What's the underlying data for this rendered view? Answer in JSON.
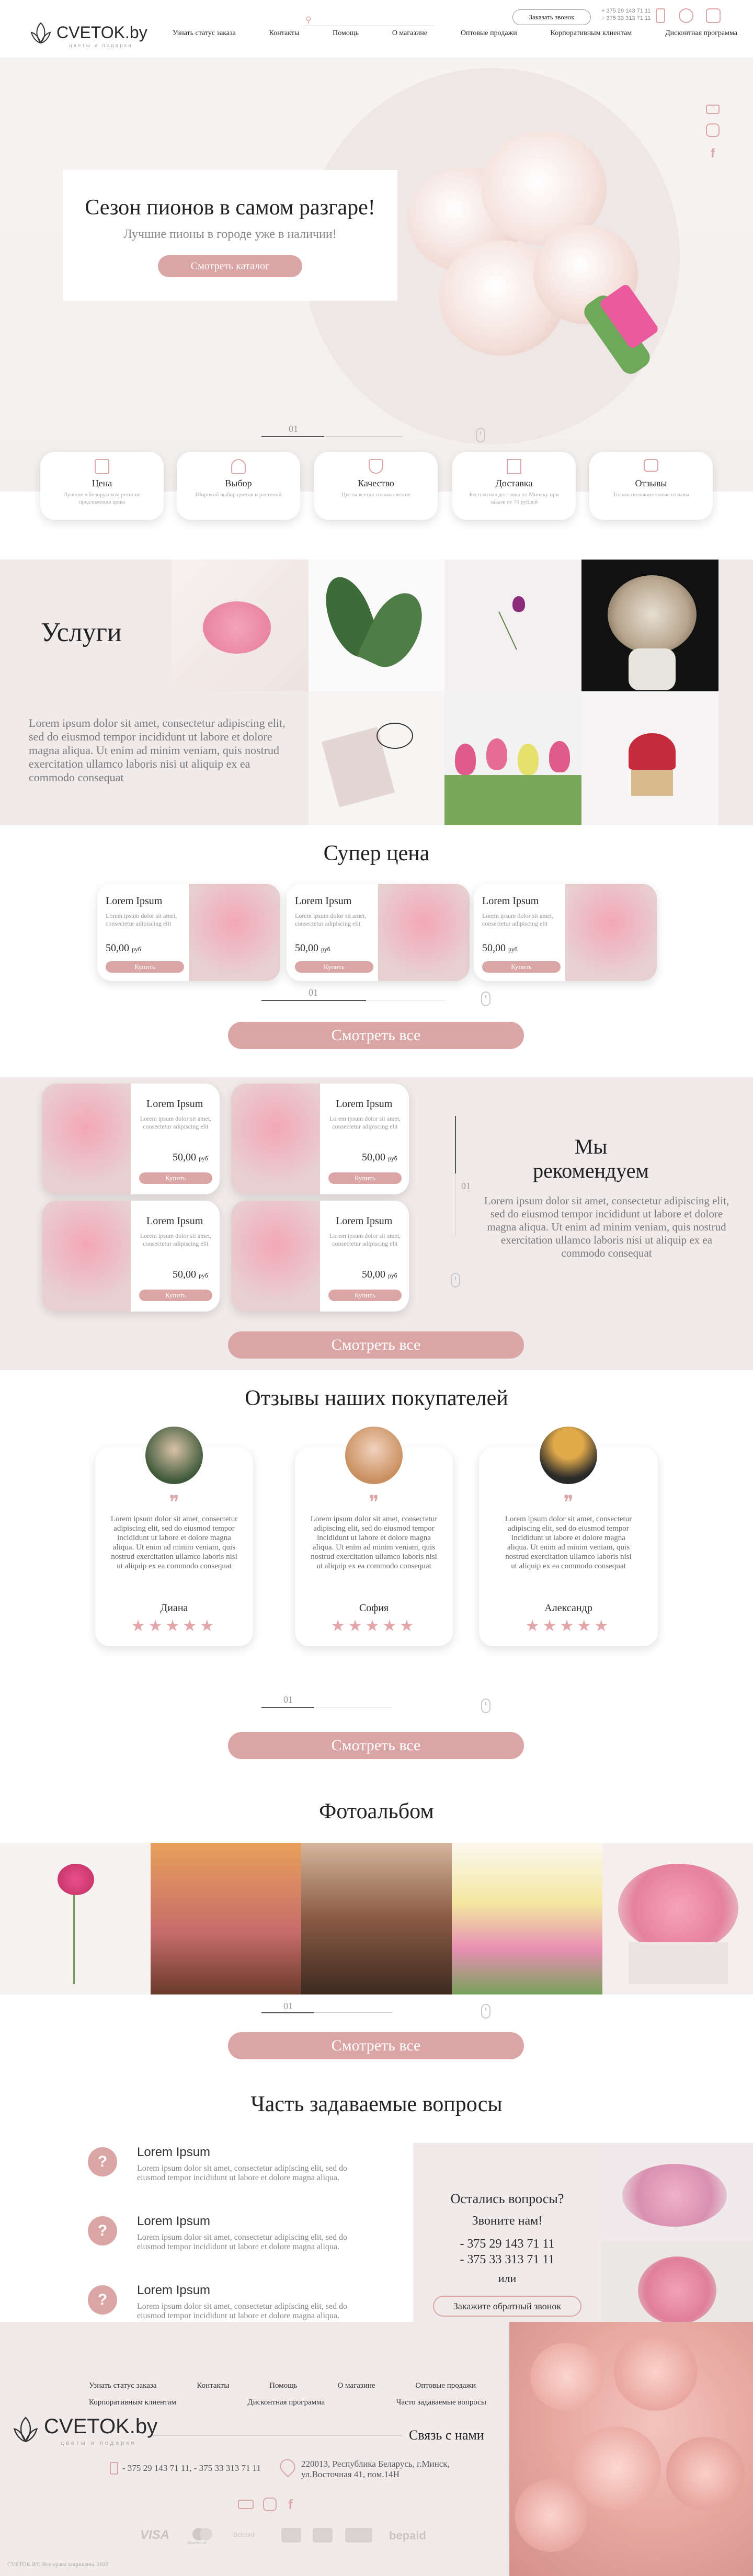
{
  "header": {
    "logo": "CVETOK.by",
    "logo_sub": "цветы и подарки",
    "order_call": "Заказать звонок",
    "phone1": "+ 375 29 143 71 11",
    "phone2": "+ 375 33 313 71 11",
    "nav": [
      "Узнать статус заказа",
      "Контакты",
      "Помощь",
      "О магазине",
      "Оптовые продажи",
      "Корпоративным клиентам",
      "Дисконтная программа"
    ]
  },
  "hero": {
    "title": "Сезон пионов в самом разгаре!",
    "subtitle": "Лучшие пионы в городе уже в наличии!",
    "button": "Смотреть каталог",
    "slide": "01"
  },
  "features": [
    {
      "title": "Цена",
      "text": "Лучшие в белорусском регионе предложения цены"
    },
    {
      "title": "Выбор",
      "text": "Широкий выбор цветов и растений"
    },
    {
      "title": "Качество",
      "text": "Цветы всегда только свежие"
    },
    {
      "title": "Доставка",
      "text": "Бесплатная доставка по Минску при заказе от 70 рублей"
    },
    {
      "title": "Отзывы",
      "text": "Только положительные отзывы"
    }
  ],
  "services": {
    "title": "Услуги",
    "text": "Lorem ipsum dolor sit amet, consectetur adipiscing elit, sed do eiusmod tempor incididunt ut labore et dolore magna aliqua. Ut enim ad minim veniam, quis nostrud exercitation ullamco laboris nisi ut aliquip ex ea commodo consequat"
  },
  "super_price": {
    "title": "Супер цена",
    "products": [
      {
        "name": "Lorem Ipsum",
        "desc": "Lorem ipsum dolor sit amet, consectetur adipiscing elit",
        "price": "50,00",
        "currency": "руб",
        "button": "Купить"
      },
      {
        "name": "Lorem Ipsum",
        "desc": "Lorem ipsum dolor sit amet, consectetur adipiscing elit",
        "price": "50,00",
        "currency": "руб",
        "button": "Купить"
      },
      {
        "name": "Lorem Ipsum",
        "desc": "Lorem ipsum dolor sit amet, consectetur adipiscing elit",
        "price": "50,00",
        "currency": "руб",
        "button": "Купить"
      }
    ],
    "slide": "01",
    "view_all": "Смотреть все"
  },
  "recommend": {
    "title": "Мы рекомендуем",
    "text": "Lorem ipsum dolor sit amet, consectetur adipiscing elit, sed do eiusmod tempor incididunt ut labore et dolore magna aliqua. Ut enim ad minim veniam, quis nostrud exercitation ullamco laboris nisi ut aliquip ex ea commodo consequat",
    "slide": "01",
    "products": [
      {
        "name": "Lorem Ipsum",
        "desc": "Lorem ipsum dolor sit amet, consectetur adipiscing elit",
        "price": "50,00",
        "currency": "руб",
        "button": "Купить"
      },
      {
        "name": "Lorem Ipsum",
        "desc": "Lorem ipsum dolor sit amet, consectetur adipiscing elit",
        "price": "50,00",
        "currency": "руб",
        "button": "Купить"
      },
      {
        "name": "Lorem Ipsum",
        "desc": "Lorem ipsum dolor sit amet, consectetur adipiscing elit",
        "price": "50,00",
        "currency": "руб",
        "button": "Купить"
      },
      {
        "name": "Lorem Ipsum",
        "desc": "Lorem ipsum dolor sit amet, consectetur adipiscing elit",
        "price": "50,00",
        "currency": "руб",
        "button": "Купить"
      }
    ],
    "view_all": "Смотреть все"
  },
  "reviews": {
    "title": "Отзывы наших покупателей",
    "items": [
      {
        "text": "Lorem ipsum dolor sit amet, consectetur adipiscing elit, sed do eiusmod tempor incididunt ut labore et dolore magna aliqua. Ut enim ad minim veniam, quis nostrud exercitation ullamco laboris nisi ut aliquip ex ea commodo consequat",
        "name": "Диана",
        "stars": "★★★★★"
      },
      {
        "text": "Lorem ipsum dolor sit amet, consectetur adipiscing elit, sed do eiusmod tempor incididunt ut labore et dolore magna aliqua. Ut enim ad minim veniam, quis nostrud exercitation ullamco laboris nisi ut aliquip ex ea commodo consequat",
        "name": "София",
        "stars": "★★★★★"
      },
      {
        "text": "Lorem ipsum dolor sit amet, consectetur adipiscing elit, sed do eiusmod tempor incididunt ut labore et dolore magna aliqua. Ut enim ad minim veniam, quis nostrud exercitation ullamco laboris nisi ut aliquip ex ea commodo consequat",
        "name": "Александр",
        "stars": "★★★★★"
      }
    ],
    "slide": "01",
    "view_all": "Смотреть все"
  },
  "album": {
    "title": "Фотоальбом",
    "slide": "01",
    "view_all": "Смотреть все"
  },
  "faq": {
    "title": "Часть задаваемые вопросы",
    "items": [
      {
        "q": "Lorem Ipsum",
        "a": "Lorem ipsum dolor sit amet, consectetur adipiscing elit, sed do eiusmod tempor incididunt ut labore et dolore magna aliqua."
      },
      {
        "q": "Lorem Ipsum",
        "a": "Lorem ipsum dolor sit amet, consectetur adipiscing elit, sed do eiusmod tempor incididunt ut labore et dolore magna aliqua."
      },
      {
        "q": "Lorem Ipsum",
        "a": "Lorem ipsum dolor sit amet, consectetur adipiscing elit, sed do eiusmod tempor incididunt ut labore et dolore magna aliqua."
      }
    ],
    "contact_title": "Остались вопросы?",
    "contact_sub": "Звоните нам!",
    "phone1": "- 375 29 143 71 11",
    "phone2": "- 375 33 313 71 11",
    "or": "или",
    "callback": "Закажите обратный звонок"
  },
  "footer": {
    "nav1": [
      "Узнать статус заказа",
      "Контакты",
      "Помощь",
      "О магазине",
      "Оптовые продажи"
    ],
    "nav2": [
      "Корпоративным клиентам",
      "Дисконтная программа",
      "Часто задаваемые вопросы"
    ],
    "logo": "CVETOK.by",
    "logo_sub": "цветы и подарки",
    "contact_us": "Связь с нами",
    "phones": "- 375 29 143 71 11, - 375 33 313 71 11",
    "address": "220013, Республика Беларусь, г.Минск, ул.Восточная 41, пом.14Н",
    "payments": [
      "VISA",
      "Mastercard",
      "Belcard",
      "",
      "",
      "",
      "bepaid"
    ],
    "copyright": "CVETOK.BY. Все права защищены. 2020"
  },
  "colors": {
    "accent": "#dba5a5",
    "soft_bg": "#f0eaea",
    "text": "#2a2a2a"
  }
}
